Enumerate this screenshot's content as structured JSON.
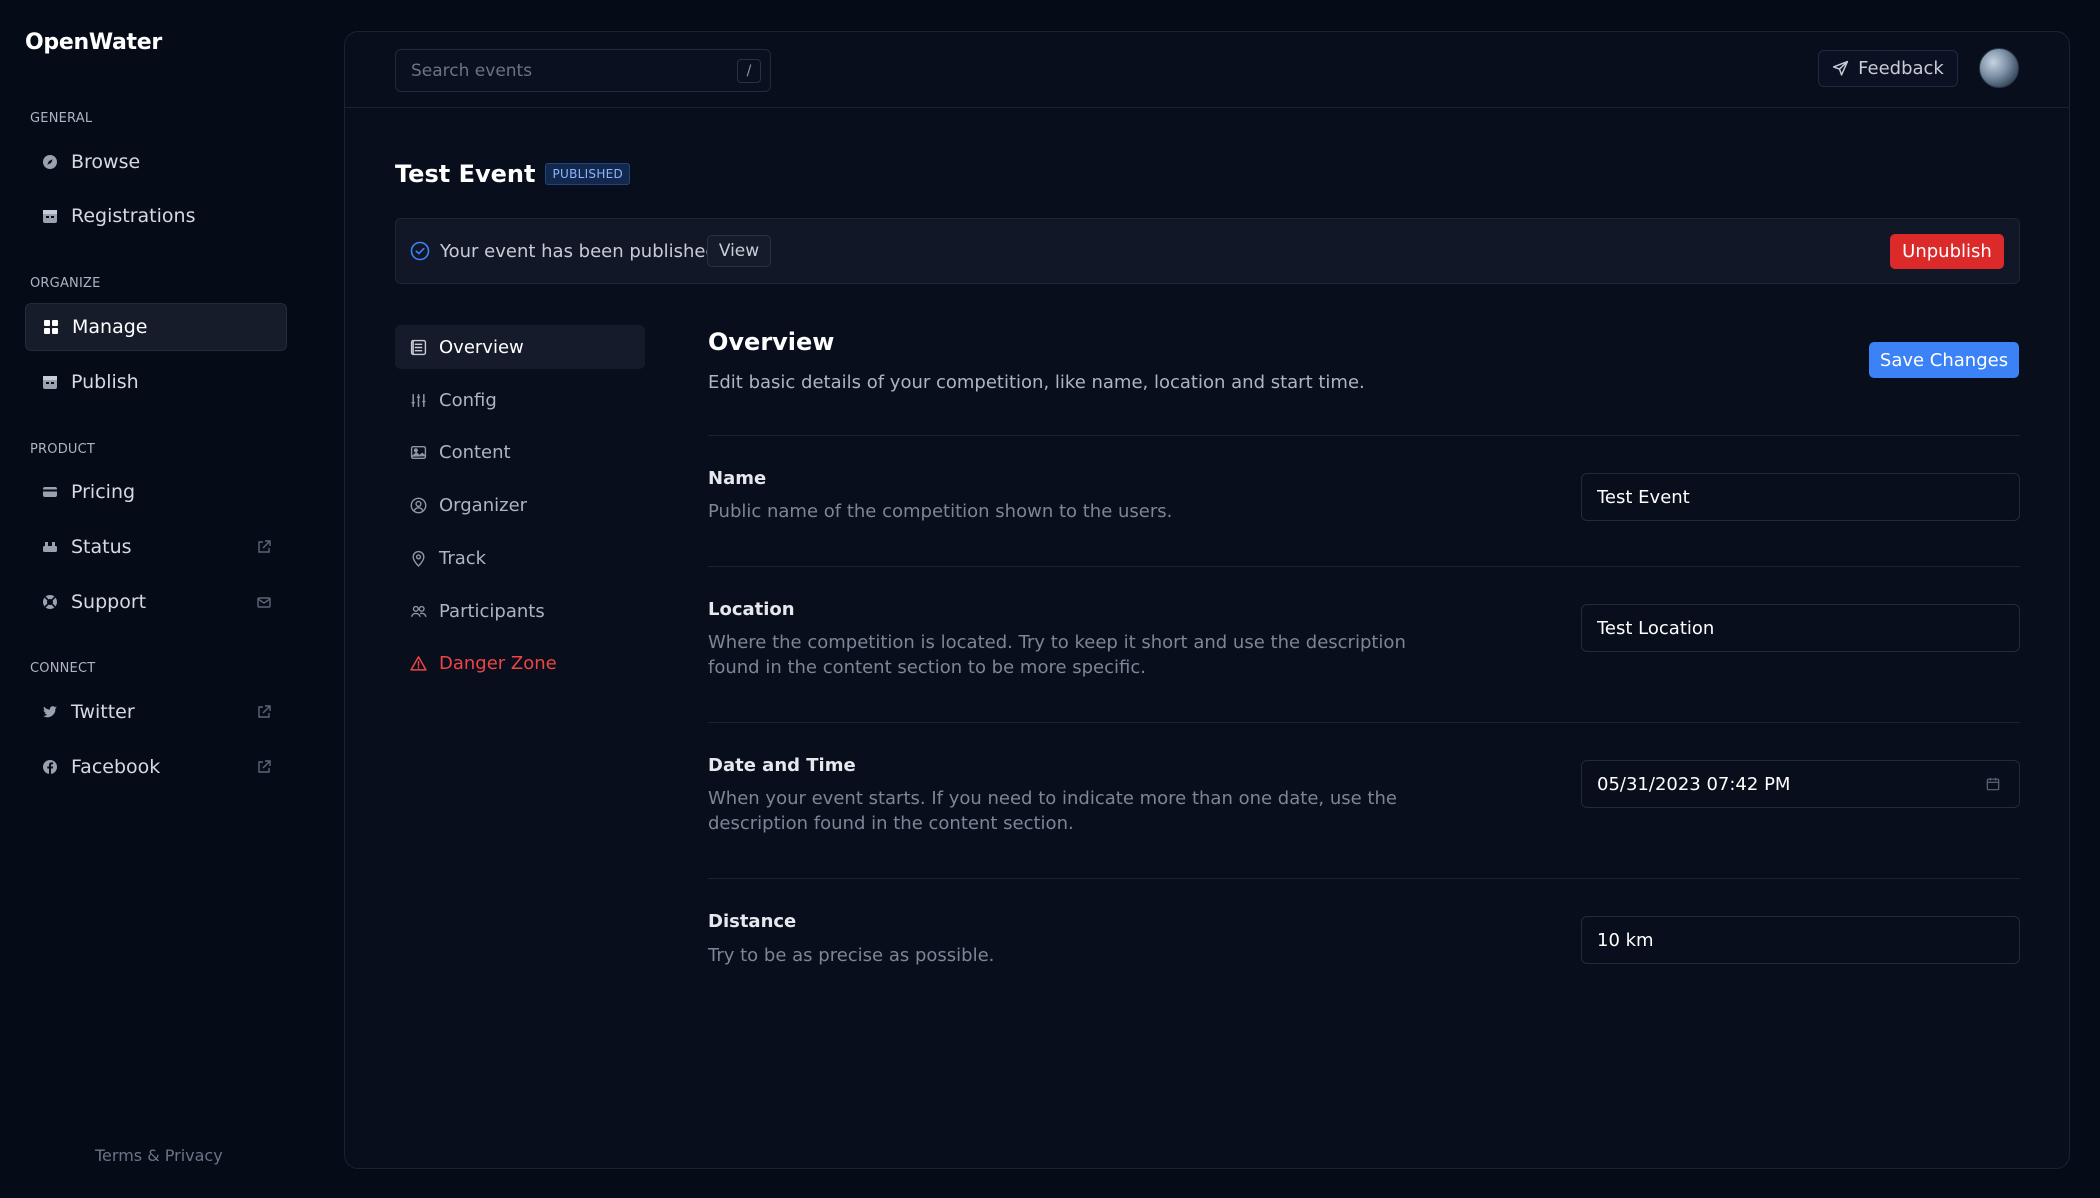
{
  "app": {
    "name": "OpenWater"
  },
  "sidebar": {
    "sections": [
      {
        "label": "GENERAL",
        "items": [
          {
            "label": "Browse",
            "icon": "compass-icon"
          },
          {
            "label": "Registrations",
            "icon": "calendar-icon"
          }
        ]
      },
      {
        "label": "ORGANIZE",
        "items": [
          {
            "label": "Manage",
            "icon": "grid-icon",
            "active": true
          },
          {
            "label": "Publish",
            "icon": "calendar-icon"
          }
        ]
      },
      {
        "label": "PRODUCT",
        "items": [
          {
            "label": "Pricing",
            "icon": "credit-card-icon"
          },
          {
            "label": "Status",
            "icon": "server-icon",
            "external": true
          },
          {
            "label": "Support",
            "icon": "lifebuoy-icon",
            "mail": true
          }
        ]
      },
      {
        "label": "CONNECT",
        "items": [
          {
            "label": "Twitter",
            "icon": "twitter-icon",
            "external": true
          },
          {
            "label": "Facebook",
            "icon": "facebook-icon",
            "external": true
          }
        ]
      }
    ],
    "footer_link": "Terms & Privacy"
  },
  "topbar": {
    "search_placeholder": "Search events",
    "search_shortcut": "/",
    "feedback_label": "Feedback"
  },
  "event": {
    "title": "Test Event",
    "status_badge": "PUBLISHED"
  },
  "alert": {
    "message": "Your event has been published!",
    "view_label": "View",
    "unpublish_label": "Unpublish"
  },
  "tabs": [
    {
      "label": "Overview",
      "icon": "list-icon",
      "active": true
    },
    {
      "label": "Config",
      "icon": "sliders-icon"
    },
    {
      "label": "Content",
      "icon": "image-icon"
    },
    {
      "label": "Organizer",
      "icon": "user-circle-icon"
    },
    {
      "label": "Track",
      "icon": "map-pin-icon"
    },
    {
      "label": "Participants",
      "icon": "users-icon"
    },
    {
      "label": "Danger Zone",
      "icon": "warning-icon",
      "danger": true
    }
  ],
  "overview": {
    "title": "Overview",
    "description": "Edit basic details of your competition, like name, location and start time.",
    "save_label": "Save Changes",
    "fields": [
      {
        "label": "Name",
        "help": "Public name of the competition shown to the users.",
        "value": "Test Event"
      },
      {
        "label": "Location",
        "help": "Where the competition is located. Try to keep it short and use the description found in the content section to be more specific.",
        "value": "Test Location"
      },
      {
        "label": "Date and Time",
        "help": "When your event starts. If you need to indicate more than one date, use the description found in the content section.",
        "value": "05/31/2023 07:42 PM"
      },
      {
        "label": "Distance",
        "help": "Try to be as precise as possible.",
        "value": "10 km"
      }
    ]
  },
  "colors": {
    "background": "#060b18",
    "accent": "#3b82f6",
    "danger": "#dc2a2a",
    "badge": "#13284d"
  }
}
